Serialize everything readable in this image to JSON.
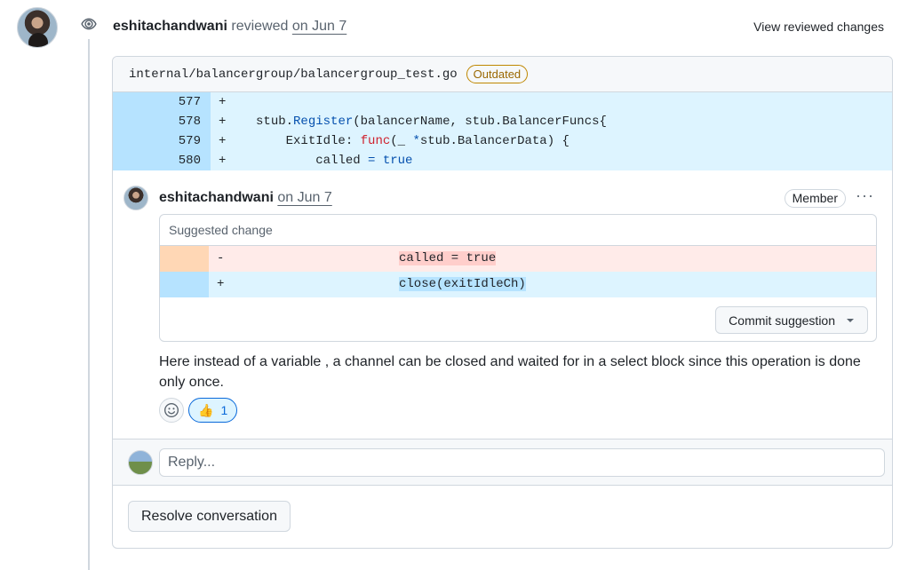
{
  "review": {
    "author": "eshitachandwani",
    "action": "reviewed",
    "date": "on Jun 7",
    "view_changes": "View reviewed changes"
  },
  "file": {
    "path": "internal/balancergroup/balancergroup_test.go",
    "badge": "Outdated"
  },
  "diff": {
    "lines": [
      {
        "num": "577",
        "sign": "+"
      },
      {
        "num": "578",
        "sign": "+"
      },
      {
        "num": "579",
        "sign": "+"
      },
      {
        "num": "580",
        "sign": "+"
      }
    ],
    "code": {
      "l578_a": "stub.",
      "l578_fn": "Register",
      "l578_b": "(balancerName, stub.BalancerFuncs{",
      "l579_a": "ExitIdle: ",
      "l579_kw": "func",
      "l579_b": "(_ ",
      "l579_op": "*",
      "l579_c": "stub.BalancerData) {",
      "l580_a": "called ",
      "l580_op": "= true"
    }
  },
  "comment": {
    "author": "eshitachandwani",
    "date": "on Jun 7",
    "role": "Member",
    "menu": "···",
    "suggestion_title": "Suggested change",
    "removed_sign": "-",
    "removed_code": "called = true",
    "added_sign": "+",
    "added_code": "close(exitIdleCh)",
    "commit_label": "Commit suggestion",
    "body": "Here instead of a variable , a channel can be closed and waited for in a select block since this operation is done only once.",
    "reaction_emoji": "👍",
    "reaction_count": "1"
  },
  "reply": {
    "placeholder": "Reply..."
  },
  "resolve_label": "Resolve conversation"
}
